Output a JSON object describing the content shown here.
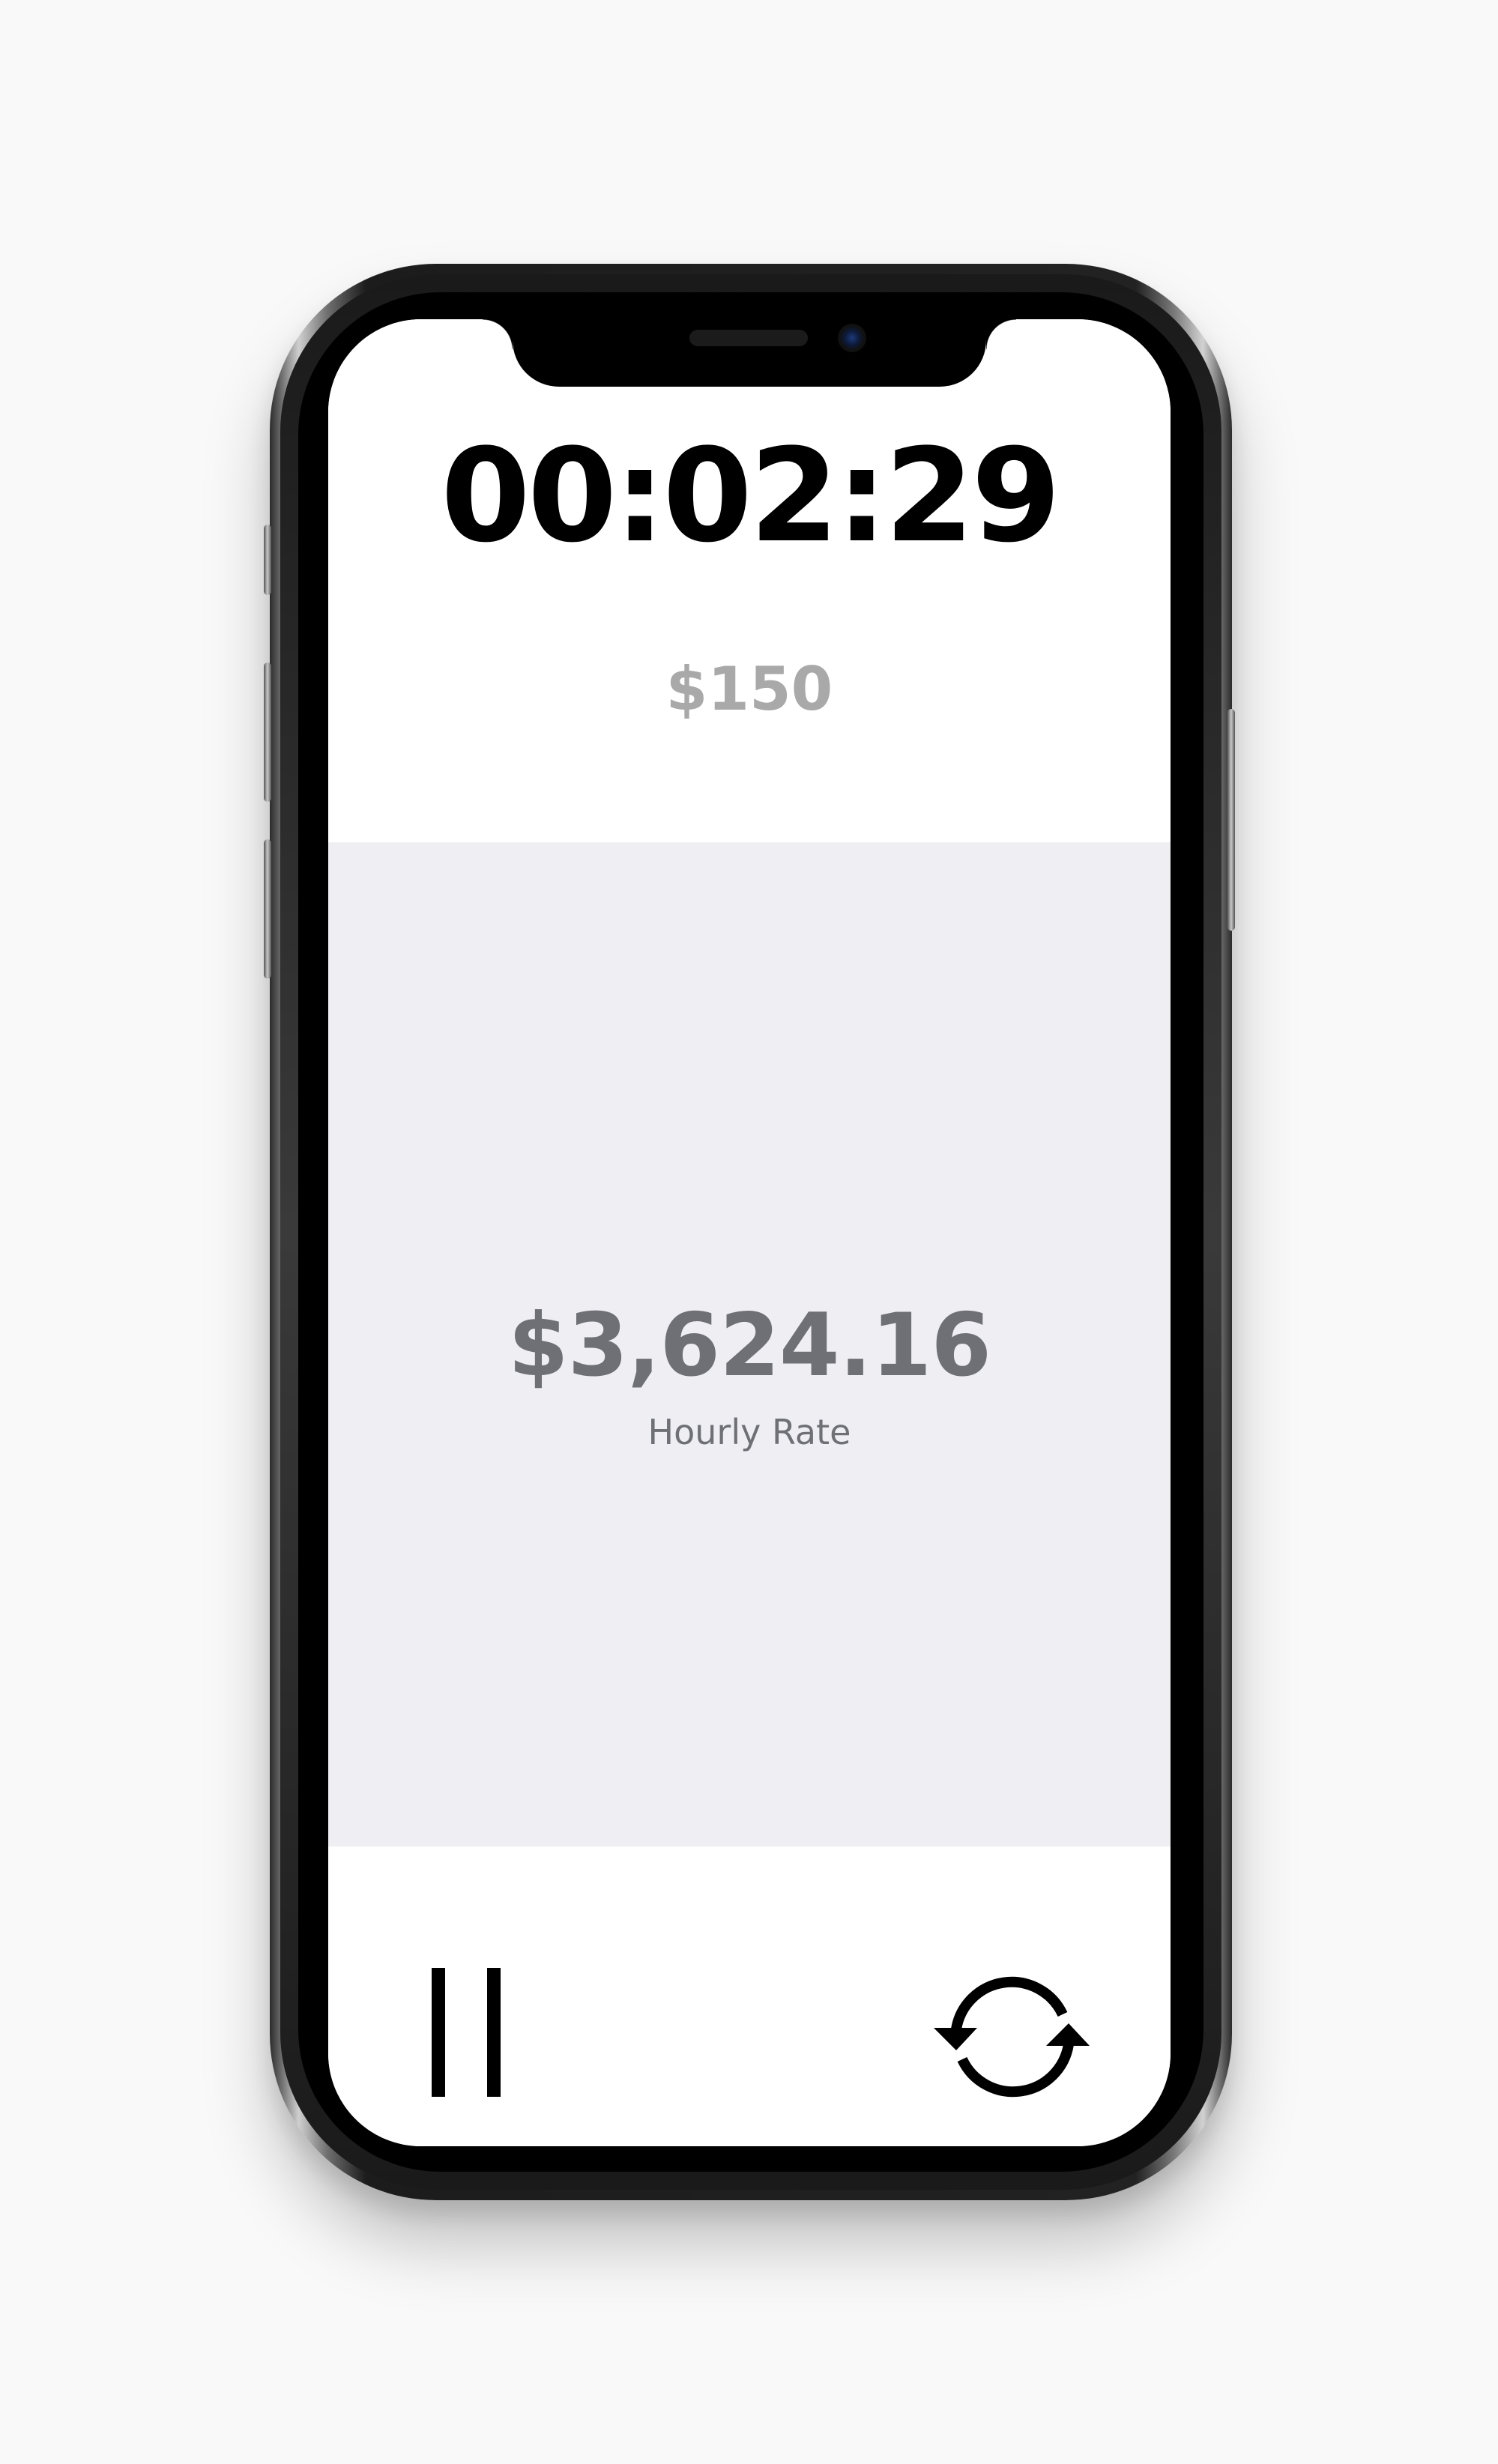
{
  "timer": {
    "elapsed": "00:02:29",
    "hourly_rate": "$150"
  },
  "earnings": {
    "amount": "$3,624.16",
    "caption": "Hourly Rate"
  },
  "controls": {
    "pause_icon": "pause-icon",
    "reset_icon": "refresh-icon"
  },
  "colors": {
    "background": "#f9f9f9",
    "timer_text": "#000000",
    "rate_text": "#a9a9a9",
    "earnings_panel": "#efeff3",
    "earnings_text": "#6f7076"
  }
}
